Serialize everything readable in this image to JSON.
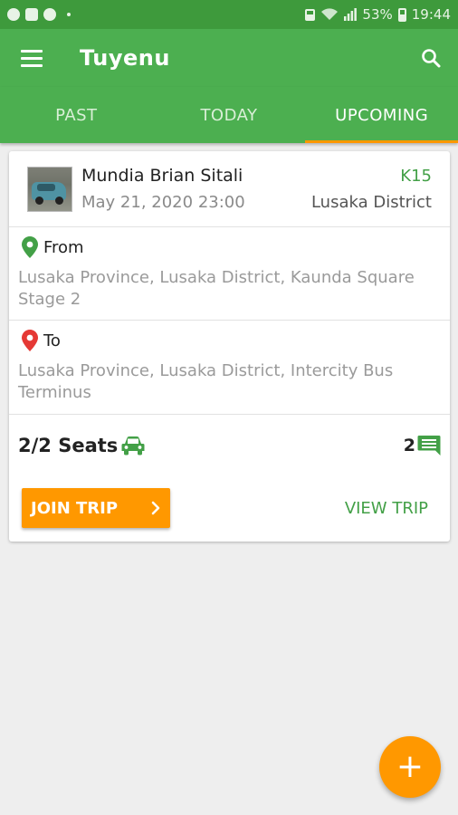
{
  "status_bar": {
    "battery": "53%",
    "time": "19:44"
  },
  "app_bar": {
    "title": "Tuyenu",
    "menu_icon": "hamburger-menu-icon",
    "search_icon": "search-icon"
  },
  "tabs": [
    {
      "label": "PAST",
      "active": false
    },
    {
      "label": "TODAY",
      "active": false
    },
    {
      "label": "UPCOMING",
      "active": true
    }
  ],
  "trip": {
    "driver_name": "Mundia Brian Sitali",
    "datetime": "May 21, 2020 23:00",
    "price": "K15",
    "district": "Lusaka District",
    "from_label": "From",
    "from_address": "Lusaka Province, Lusaka District, Kaunda Square Stage 2",
    "to_label": "To",
    "to_address": "Lusaka Province, Lusaka District, Intercity Bus Terminus",
    "seats": "2/2 Seats",
    "comments": "2",
    "join_label": "JOIN TRIP",
    "view_label": "VIEW TRIP"
  },
  "fab": {
    "label": "+"
  },
  "colors": {
    "primary": "#4caf50",
    "primary_dark": "#3e9a3c",
    "accent": "#ff9800",
    "from_pin": "#43a047",
    "to_pin": "#e53935"
  }
}
